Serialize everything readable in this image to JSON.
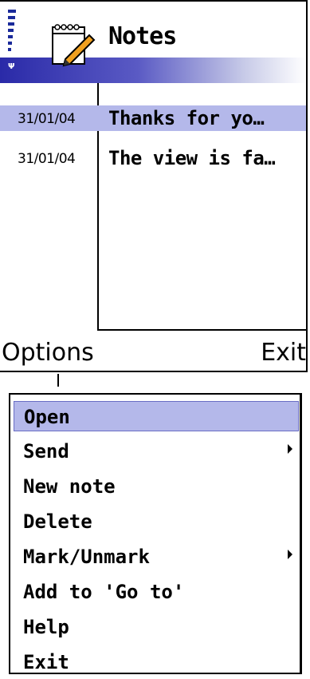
{
  "app": {
    "title": "Notes"
  },
  "status": {
    "antenna_icon": "antenna-icon",
    "signal_icon": "signal-strength-icon",
    "signal_bars": 7
  },
  "notes": [
    {
      "date": "31/01/04",
      "text": "Thanks for yo…",
      "selected": true
    },
    {
      "date": "31/01/04",
      "text": "The view is fa…",
      "selected": false
    }
  ],
  "softkeys": {
    "left": "Options",
    "right": "Exit"
  },
  "menu": {
    "items": [
      {
        "label": "Open",
        "selected": true,
        "submenu": false
      },
      {
        "label": "Send",
        "selected": false,
        "submenu": true
      },
      {
        "label": "New note",
        "selected": false,
        "submenu": false
      },
      {
        "label": "Delete",
        "selected": false,
        "submenu": false
      },
      {
        "label": "Mark/Unmark",
        "selected": false,
        "submenu": true
      },
      {
        "label": "Add to 'Go to'",
        "selected": false,
        "submenu": false
      },
      {
        "label": "Help",
        "selected": false,
        "submenu": false
      },
      {
        "label": "Exit",
        "selected": false,
        "submenu": false
      }
    ]
  },
  "colors": {
    "highlight": "#b4b8ea",
    "title_band": "#2a2aa8",
    "signal": "#1a2a9a"
  }
}
